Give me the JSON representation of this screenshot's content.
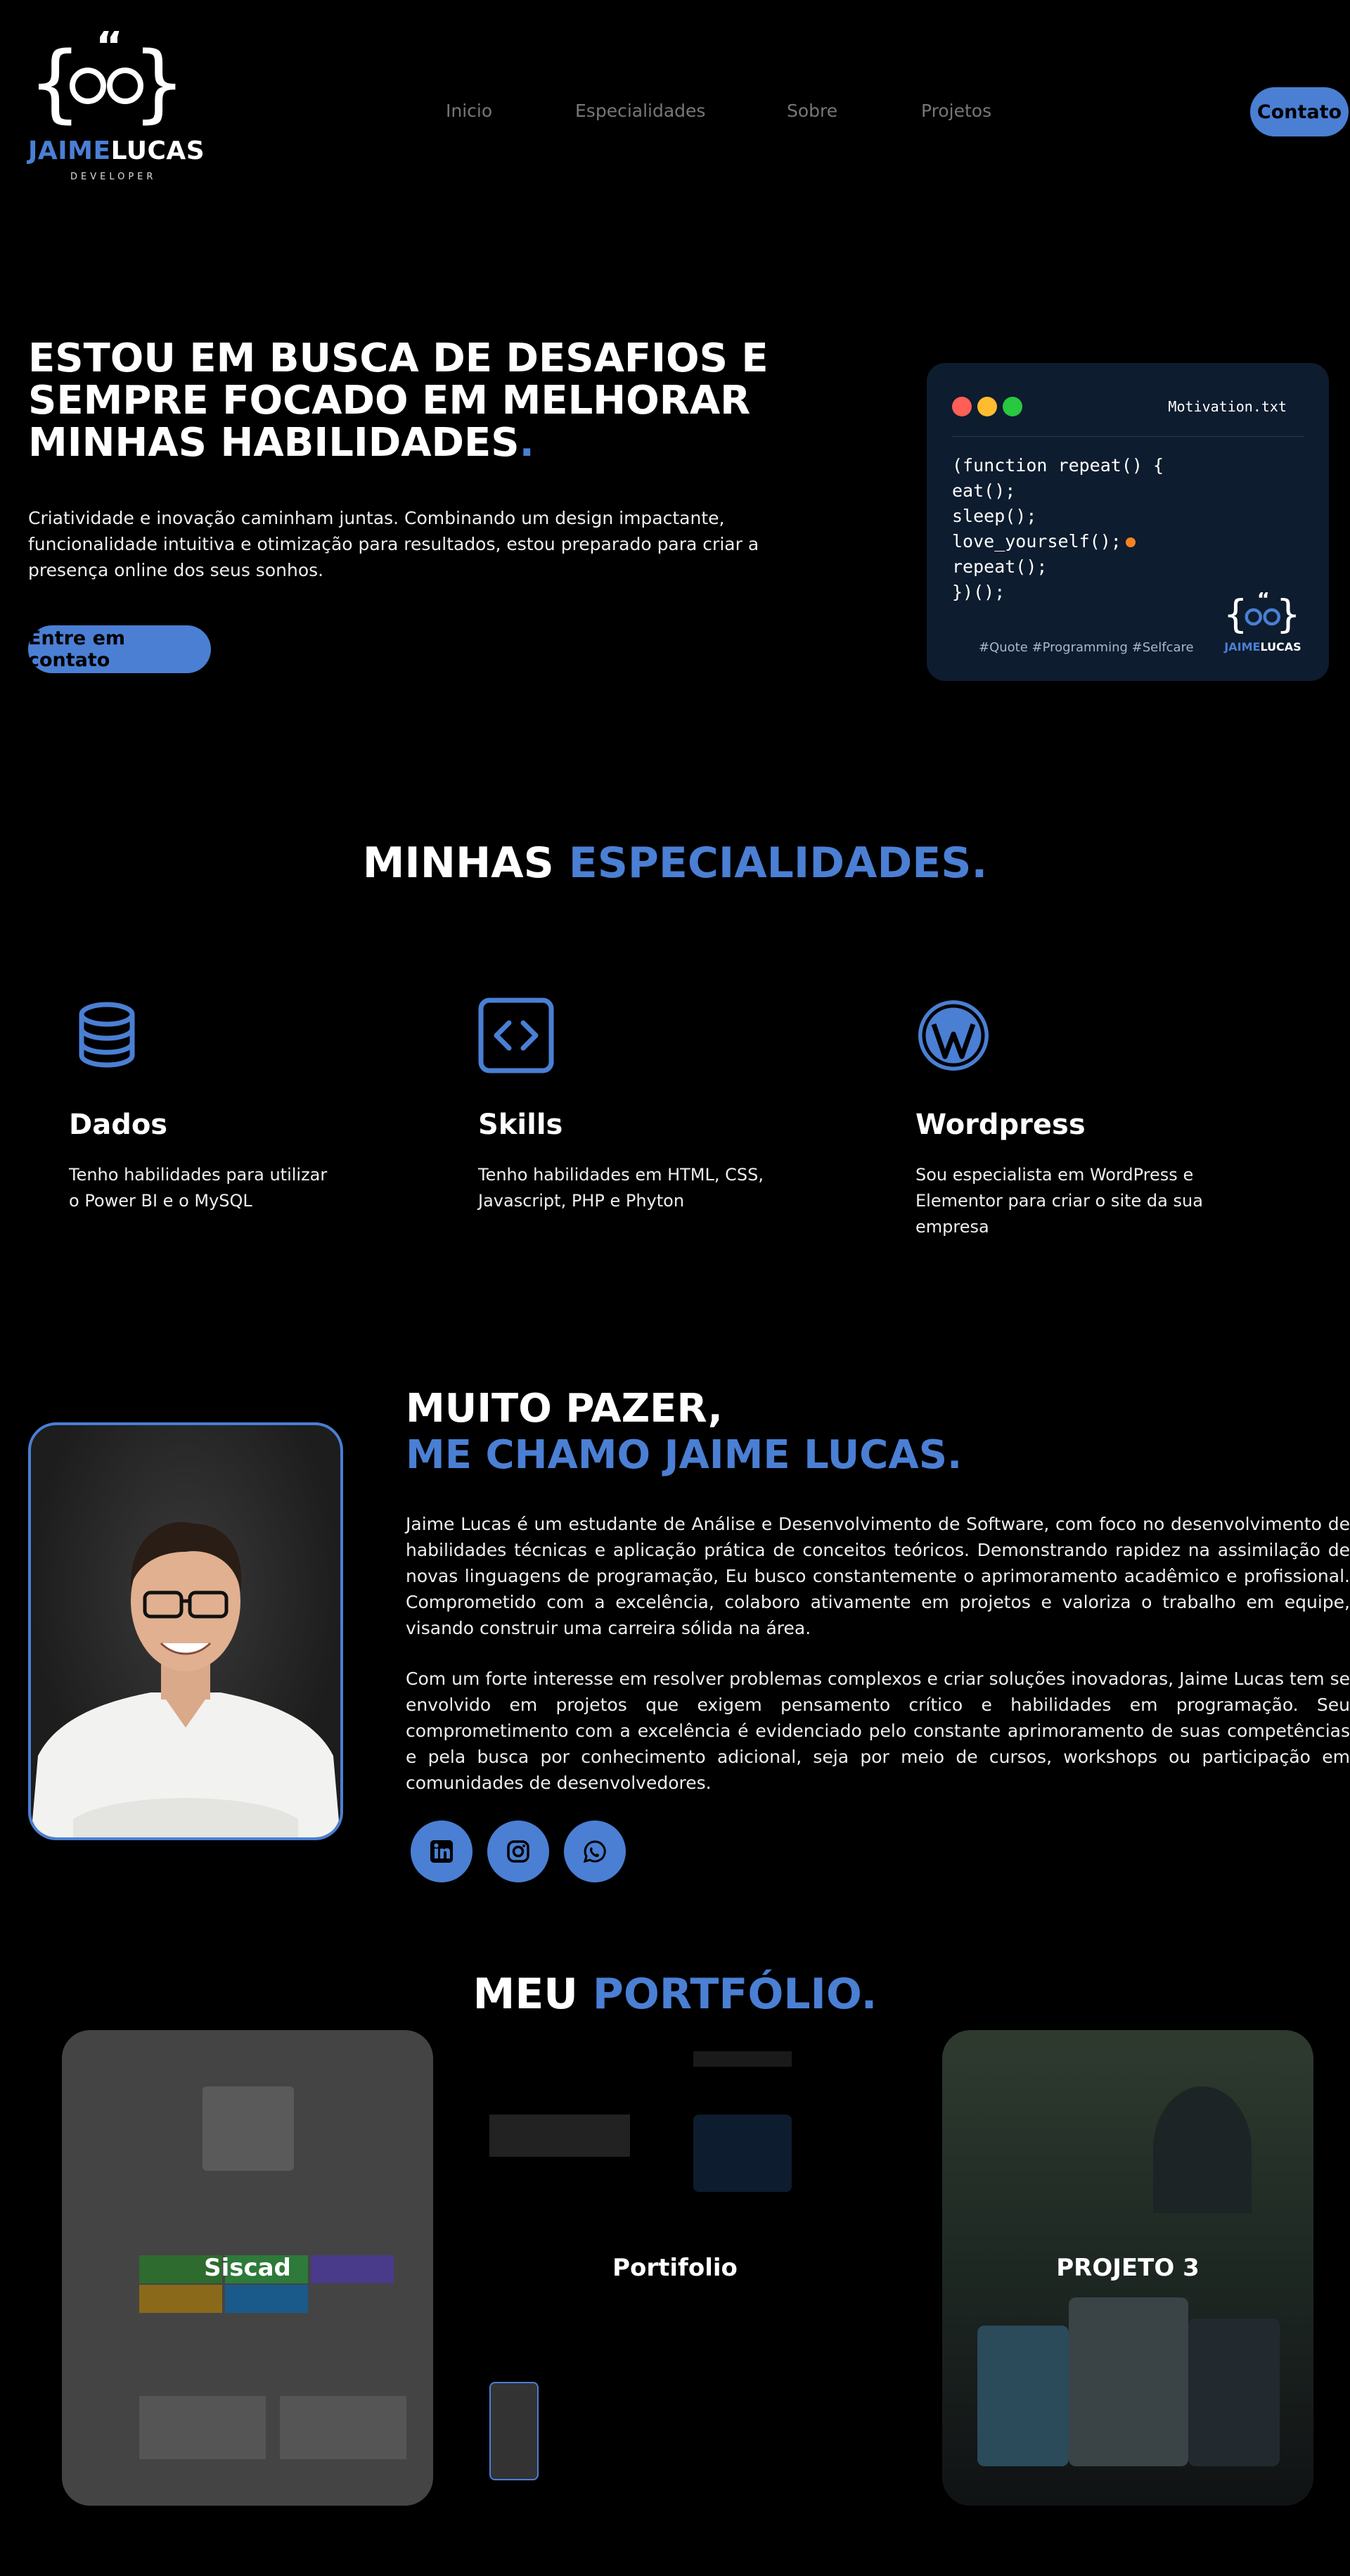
{
  "brand": {
    "first": "JAIME",
    "last": "LUCAS",
    "tagline": "DEVELOPER",
    "mark_quote": "“"
  },
  "nav": {
    "items": [
      "Inicio",
      "Especialidades",
      "Sobre",
      "Projetos"
    ],
    "contact": "Contato"
  },
  "hero": {
    "title_lines": [
      "ESTOU EM BUSCA DE DESAFIOS E",
      "SEMPRE FOCADO EM MELHORAR",
      "MINHAS HABILIDADES"
    ],
    "title_dot": ".",
    "text": "Criatividade e inovação caminham juntas. Combinando um design impactante, funcionalidade intuitiva e otimização para resultados, estou preparado para criar a presença online dos seus sonhos.",
    "button": "Entre em contato"
  },
  "code_card": {
    "file": "Motivation.txt",
    "lines": [
      "(function repeat() {",
      "eat();",
      "sleep();",
      "love_yourself();",
      "repeat();",
      "})();"
    ],
    "tags": "#Quote #Programming #Selfcare",
    "dot_colors": [
      "#ff5f57",
      "#febc2e",
      "#28c840"
    ],
    "accent_dot": "#f5841f"
  },
  "specialties": {
    "title_a": "MINHAS",
    "title_b": "ESPECIALIDADES.",
    "items": [
      {
        "icon": "database-icon",
        "title": "Dados",
        "text": "Tenho habilidades para utilizar o Power BI e o MySQL"
      },
      {
        "icon": "code-icon",
        "title": "Skills",
        "text": "Tenho habilidades em HTML, CSS, Javascript, PHP e Phyton"
      },
      {
        "icon": "wordpress-icon",
        "title": "Wordpress",
        "text": "Sou especialista em WordPress e Elementor para criar o site da sua empresa"
      }
    ]
  },
  "about": {
    "title_a": "MUITO PAZER,",
    "title_b": "ME CHAMO JAIME LUCAS.",
    "p1": "Jaime Lucas é um estudante de Análise e Desenvolvimento de Software, com foco no desenvolvimento de habilidades técnicas e aplicação prática de conceitos teóricos. Demonstrando rapidez na assimilação de novas linguagens de programação, Eu busco constantemente o aprimoramento acadêmico e profissional. Comprometido com a excelência, colaboro ativamente em projetos e valoriza o trabalho em equipe, visando construir uma carreira sólida na área.",
    "p2": "Com um forte interesse em resolver problemas complexos e criar soluções inovadoras, Jaime Lucas tem se envolvido em projetos que exigem pensamento crítico e habilidades em programação. Seu comprometimento com a excelência é evidenciado pelo constante aprimoramento de suas competências e pela busca por conhecimento adicional, seja por meio de cursos, workshops ou participação em comunidades de desenvolvedores.",
    "socials": [
      "linkedin-icon",
      "instagram-icon",
      "whatsapp-icon"
    ]
  },
  "portfolio": {
    "title_a": "MEU",
    "title_b": "PORTFÓLIO.",
    "projects": [
      "Siscad",
      "Portifolio",
      "PROJETO 3"
    ]
  },
  "colors": {
    "accent": "#4a7fd4",
    "background": "#000000",
    "card": "#0d1c2e"
  }
}
